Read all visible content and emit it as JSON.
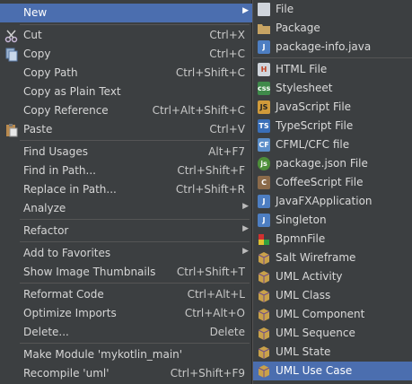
{
  "context_menu": {
    "items": [
      {
        "label": "New",
        "shortcut": "",
        "submenu": true,
        "selected": true
      },
      {
        "label": "Cut",
        "shortcut": "Ctrl+X"
      },
      {
        "label": "Copy",
        "shortcut": "Ctrl+C"
      },
      {
        "label": "Copy Path",
        "shortcut": "Ctrl+Shift+C"
      },
      {
        "label": "Copy as Plain Text",
        "shortcut": ""
      },
      {
        "label": "Copy Reference",
        "shortcut": "Ctrl+Alt+Shift+C"
      },
      {
        "label": "Paste",
        "shortcut": "Ctrl+V"
      },
      {
        "label": "Find Usages",
        "shortcut": "Alt+F7"
      },
      {
        "label": "Find in Path...",
        "shortcut": "Ctrl+Shift+F"
      },
      {
        "label": "Replace in Path...",
        "shortcut": "Ctrl+Shift+R"
      },
      {
        "label": "Analyze",
        "shortcut": "",
        "submenu": true
      },
      {
        "label": "Refactor",
        "shortcut": "",
        "submenu": true
      },
      {
        "label": "Add to Favorites",
        "shortcut": "",
        "submenu": true
      },
      {
        "label": "Show Image Thumbnails",
        "shortcut": "Ctrl+Shift+T"
      },
      {
        "label": "Reformat Code",
        "shortcut": "Ctrl+Alt+L"
      },
      {
        "label": "Optimize Imports",
        "shortcut": "Ctrl+Alt+O"
      },
      {
        "label": "Delete...",
        "shortcut": "Delete"
      },
      {
        "label": "Make Module 'mykotlin_main'",
        "shortcut": ""
      },
      {
        "label": "Recompile 'uml'",
        "shortcut": "Ctrl+Shift+F9"
      }
    ]
  },
  "new_submenu": {
    "items": [
      {
        "label": "File",
        "icon": "file-icon"
      },
      {
        "label": "Package",
        "icon": "package-icon"
      },
      {
        "label": "package-info.java",
        "icon": "java-file-icon"
      },
      {
        "label": "HTML File",
        "icon": "html-file-icon"
      },
      {
        "label": "Stylesheet",
        "icon": "css-file-icon"
      },
      {
        "label": "JavaScript File",
        "icon": "javascript-file-icon"
      },
      {
        "label": "TypeScript File",
        "icon": "typescript-file-icon"
      },
      {
        "label": "CFML/CFC file",
        "icon": "cfml-file-icon"
      },
      {
        "label": "package.json File",
        "icon": "nodejs-file-icon"
      },
      {
        "label": "CoffeeScript File",
        "icon": "coffeescript-file-icon"
      },
      {
        "label": "JavaFXApplication",
        "icon": "javafx-file-icon"
      },
      {
        "label": "Singleton",
        "icon": "singleton-icon"
      },
      {
        "label": "BpmnFile",
        "icon": "bpmn-file-icon"
      },
      {
        "label": "Salt Wireframe",
        "icon": "uml-box-icon"
      },
      {
        "label": "UML Activity",
        "icon": "uml-box-icon"
      },
      {
        "label": "UML Class",
        "icon": "uml-box-icon"
      },
      {
        "label": "UML Component",
        "icon": "uml-box-icon"
      },
      {
        "label": "UML Sequence",
        "icon": "uml-box-icon"
      },
      {
        "label": "UML State",
        "icon": "uml-box-icon"
      },
      {
        "label": "UML Use Case",
        "icon": "uml-box-icon",
        "selected": true
      }
    ]
  },
  "colors": {
    "menu_bg": "#3c3f41",
    "selection": "#4b6eaf",
    "text": "#d6d6d6"
  }
}
